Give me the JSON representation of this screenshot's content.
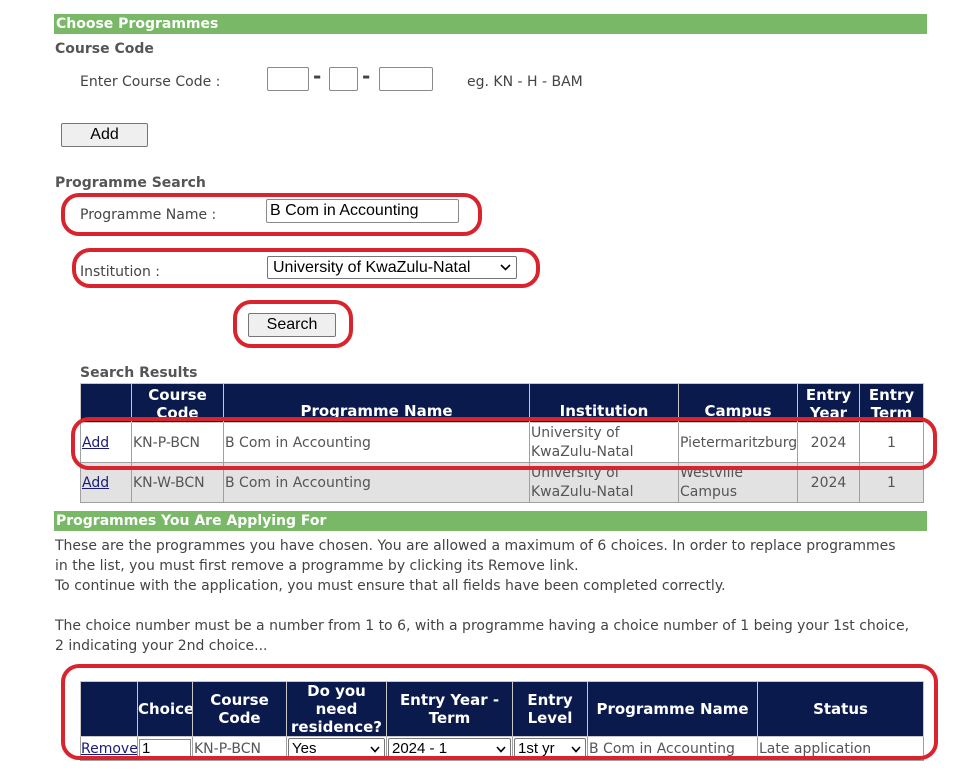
{
  "choose": {
    "title": "Choose Programmes"
  },
  "course_code": {
    "heading": "Course Code",
    "label": "Enter Course Code :",
    "part1": "",
    "part2": "",
    "part3": "",
    "separator": "-",
    "example": "eg. KN - H - BAM",
    "add_label": "Add"
  },
  "search": {
    "heading": "Programme Search",
    "name_label": "Programme Name :",
    "name_value": "B Com in Accounting",
    "institution_label": "Institution :",
    "institution_value": "University of KwaZulu-Natal",
    "button_label": "Search"
  },
  "results": {
    "heading": "Search Results",
    "headers": {
      "course_code": "Course Code",
      "programme_name": "Programme Name",
      "institution": "Institution",
      "campus": "Campus",
      "entry_year": "Entry Year",
      "entry_term": "Entry Term"
    },
    "rows": [
      {
        "action": "Add",
        "code": "KN-P-BCN",
        "name": "B Com in Accounting",
        "institution_l1": "University of",
        "institution_l2": "KwaZulu-Natal",
        "campus_l1": "Pietermaritzburg",
        "campus_l2": "",
        "year": "2024",
        "term": "1"
      },
      {
        "action": "Add",
        "code": "KN-W-BCN",
        "name": "B Com in Accounting",
        "institution_l1": "University of",
        "institution_l2": "KwaZulu-Natal",
        "campus_l1": "Westville",
        "campus_l2": "Campus",
        "year": "2024",
        "term": "1"
      }
    ]
  },
  "applying": {
    "title": "Programmes You Are Applying For",
    "para1_l1": "These are the programmes you have chosen. You are allowed a maximum of 6 choices. In order to replace programmes",
    "para1_l2": "in the list, you must first remove a programme by clicking its Remove link.",
    "para1_l3": "To continue with the application, you must ensure that all fields have been completed correctly.",
    "para2_l1": "The choice number must be a number from 1 to 6, with a programme having a choice number of 1 being your 1st choice,",
    "para2_l2": "2 indicating your 2nd choice...",
    "headers": {
      "choice": "Choice",
      "course_code": "Course Code",
      "residence": "Do you need residence?",
      "entry_year_term": "Entry Year - Term",
      "entry_level": "Entry Level",
      "programme_name": "Programme Name",
      "status": "Status"
    },
    "row": {
      "action": "Remove",
      "choice": "1",
      "code": "KN-P-BCN",
      "residence": "Yes",
      "year_term": "2024 - 1",
      "level": "1st yr",
      "name": "B Com in Accounting",
      "status": "Late application"
    }
  },
  "colors": {
    "section_bar": "#78b866",
    "table_header": "#0b1a4d",
    "highlight": "#d9232d"
  }
}
